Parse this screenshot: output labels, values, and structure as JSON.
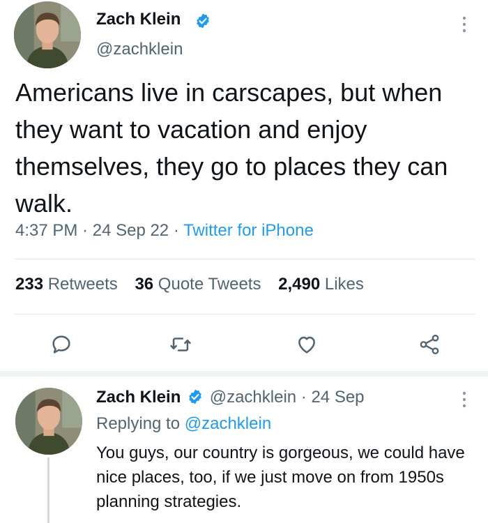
{
  "tweet": {
    "author": {
      "name": "Zach Klein",
      "handle": "@zachklein"
    },
    "text": "Americans live in carscapes, but when they want to vacation and enjoy themselves, they go to places they can walk.",
    "time": "4:37 PM",
    "sep1": " · ",
    "date": "24 Sep 22",
    "sep2": " · ",
    "source": "Twitter for iPhone",
    "stats": {
      "retweets_count": "233",
      "retweets_label": " Retweets",
      "quotes_count": "36",
      "quotes_label": " Quote Tweets",
      "likes_count": "2,490",
      "likes_label": " Likes"
    },
    "actions": [
      "reply-icon",
      "retweet-icon",
      "like-icon",
      "share-icon"
    ]
  },
  "reply": {
    "author": {
      "name": "Zach Klein",
      "handle": "@zachklein"
    },
    "sep": " · ",
    "date": "24 Sep",
    "replying_label": "Replying to ",
    "replying_to": "@zachklein",
    "text": "You guys, our country is gorgeous, we could have nice places, too, if we just move on from 1950s planning strategies."
  },
  "colors": {
    "accent": "#1d9bf0",
    "text": "#0f1419",
    "muted": "#536471",
    "divider": "#e6e9ec"
  }
}
